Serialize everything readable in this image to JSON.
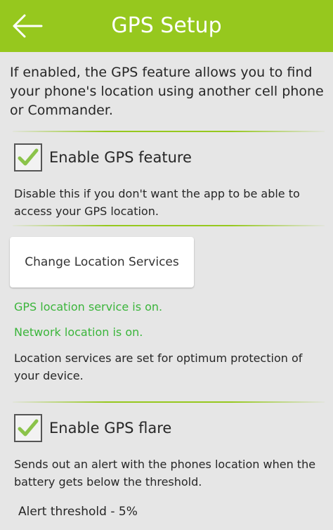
{
  "header": {
    "title": "GPS Setup",
    "back_icon": "back-arrow-icon"
  },
  "intro": "If enabled, the GPS feature allows you to find your phone's location using another cell phone or Commander.",
  "gps_feature": {
    "label": "Enable GPS feature",
    "checked": true,
    "description": "Disable this if you don't want the app to be able to access your GPS location."
  },
  "location_services": {
    "button_label": "Change Location Services",
    "gps_status": "GPS location service is on.",
    "network_status": "Network location is on.",
    "summary": "Location services are set for optimum protection of your device."
  },
  "gps_flare": {
    "label": "Enable GPS flare",
    "checked": true,
    "description": "Sends out an alert with the phones location when the battery gets below the threshold."
  },
  "alert_threshold": "Alert threshold - 5%",
  "colors": {
    "accent": "#96c81e",
    "status_green": "#3bb53b",
    "background": "#e6e6e6"
  }
}
